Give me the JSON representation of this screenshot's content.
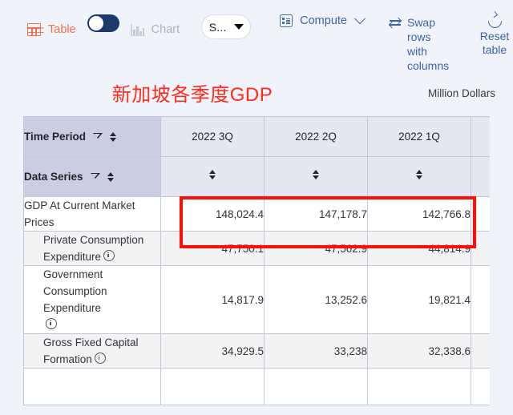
{
  "toolbar": {
    "table_icon": "table-grid-icon",
    "table_label": "Table",
    "view_toggle": {
      "name": "table-chart-toggle",
      "state": "table"
    },
    "chart_icon": "bar-chart-icon",
    "chart_label": "Chart",
    "select": {
      "value": "S...",
      "caret_icon": "caret-down-icon"
    },
    "compute_icon": "compute-icon",
    "compute_label": "Compute",
    "compute_chevron": "chevron-down-icon",
    "swap_icon": "swap-arrows-icon",
    "swap_label_line1": "Swap rows",
    "swap_label_line2": "with columns",
    "reset_icon": "reset-circular-arrow-icon",
    "reset_label_line1": "Reset",
    "reset_label_line2": "table"
  },
  "title": {
    "text": "新加坡各季度GDP",
    "color": "#ff2b1c",
    "unit": "Million Dollars"
  },
  "table": {
    "corner_header_top": "Time Period",
    "corner_header_bottom": "Data Series",
    "filter_icon": "funnel-filter-icon",
    "sort_icon": "sort-updown-icon",
    "columns": [
      "2022 3Q",
      "2022 2Q",
      "2022 1Q"
    ],
    "rows": [
      {
        "label": "GDP At Current Market Prices",
        "indent": false,
        "info": false,
        "values": [
          "148,024.4",
          "147,178.7",
          "142,766.8"
        ]
      },
      {
        "label": "Private Consumption Expenditure",
        "indent": true,
        "info": true,
        "values": [
          "47,750.1",
          "47,562.9",
          "44,814.9"
        ]
      },
      {
        "label": "Government Consumption Expenditure",
        "indent": true,
        "info": true,
        "values": [
          "14,817.9",
          "13,252.6",
          "19,821.4"
        ]
      },
      {
        "label": "Gross Fixed Capital Formation",
        "indent": true,
        "info": true,
        "values": [
          "34,929.5",
          "33,238",
          "32,338.6"
        ]
      },
      {
        "label": "",
        "indent": true,
        "info": false,
        "values": [
          "",
          "",
          ""
        ]
      }
    ],
    "highlight": {
      "name": "red-highlight-box",
      "color": "#fb0f06"
    }
  }
}
